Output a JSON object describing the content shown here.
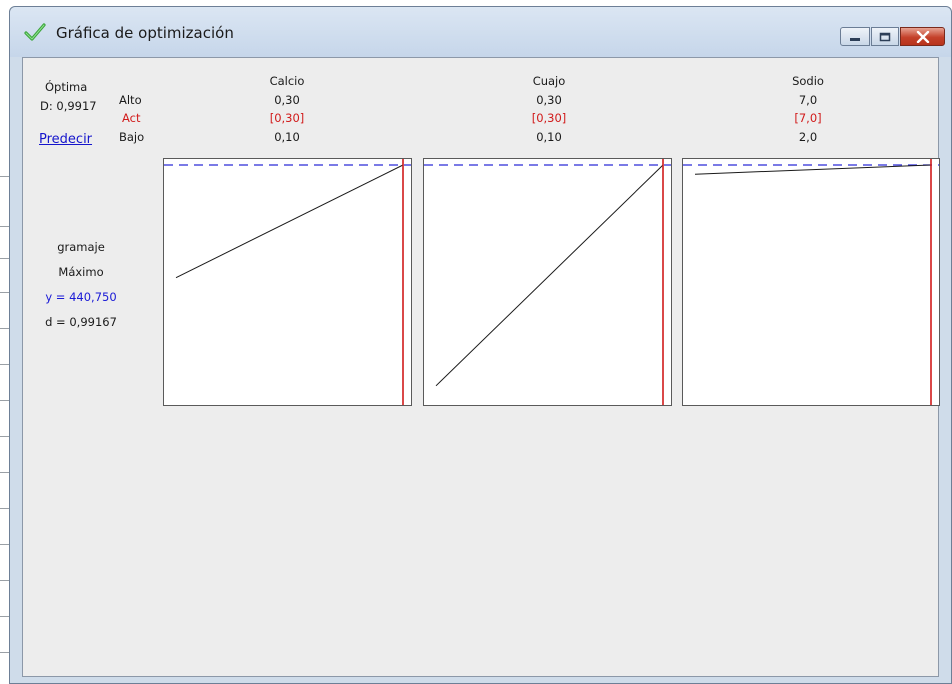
{
  "window": {
    "title": "Gráfica de optimización",
    "icon": "green-check-icon"
  },
  "summary": {
    "optimal_label": "Óptima",
    "d_value": "D: 0,9917",
    "predict_link": "Predecir"
  },
  "row_labels": {
    "high": "Alto",
    "current": "Act",
    "low": "Bajo"
  },
  "factors": [
    {
      "name": "Calcio",
      "high": "0,30",
      "current": "[0,30]",
      "low": "0,10"
    },
    {
      "name": "Cuajo",
      "high": "0,30",
      "current": "[0,30]",
      "low": "0,10"
    },
    {
      "name": "Sodio",
      "high": "7,0",
      "current": "[7,0]",
      "low": "2,0"
    }
  ],
  "response": {
    "name": "gramaje",
    "goal": "Máximo",
    "y_text": "y = 440,750",
    "d_text": "d = 0,99167"
  },
  "colors": {
    "current_line": "#d11a1a",
    "target_line": "#2a2ad8",
    "trace": "#1a1a1a"
  },
  "chart_data": [
    {
      "type": "line",
      "factor": "Calcio",
      "xlim": [
        0.1,
        0.3
      ],
      "x": [
        0.1,
        0.3
      ],
      "y_norm": [
        0.51,
        1.0
      ],
      "current_x": 0.3,
      "target_y_norm": 1.0
    },
    {
      "type": "line",
      "factor": "Cuajo",
      "xlim": [
        0.1,
        0.3
      ],
      "x": [
        0.1,
        0.3
      ],
      "y_norm": [
        0.04,
        1.0
      ],
      "current_x": 0.3,
      "target_y_norm": 1.0
    },
    {
      "type": "line",
      "factor": "Sodio",
      "xlim": [
        2.0,
        7.0
      ],
      "x": [
        2.0,
        7.0
      ],
      "y_norm": [
        0.96,
        1.0
      ],
      "current_x": 7.0,
      "target_y_norm": 1.0
    }
  ]
}
